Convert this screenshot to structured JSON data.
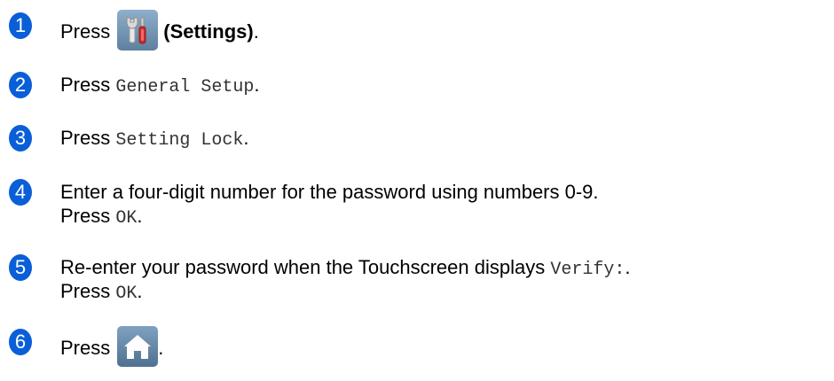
{
  "steps": [
    {
      "number": "1",
      "lines": [
        {
          "prefix": "Press",
          "icon": "settings-icon",
          "bold": "(Settings)",
          "suffix": "."
        }
      ]
    },
    {
      "number": "2",
      "lines": [
        {
          "prefix": "Press ",
          "mono": "General Setup",
          "suffix": "."
        }
      ]
    },
    {
      "number": "3",
      "lines": [
        {
          "prefix": "Press ",
          "mono": "Setting Lock",
          "suffix": "."
        }
      ]
    },
    {
      "number": "4",
      "lines": [
        {
          "text": "Enter a four-digit number for the password using numbers 0-9."
        },
        {
          "prefix": "Press ",
          "mono": "OK",
          "suffix": "."
        }
      ]
    },
    {
      "number": "5",
      "lines": [
        {
          "prefix": "Re-enter your password when the Touchscreen displays ",
          "mono": "Verify:",
          "suffix": "."
        },
        {
          "prefix": "Press ",
          "mono": "OK",
          "suffix": "."
        }
      ]
    },
    {
      "number": "6",
      "lines": [
        {
          "prefix": "Press",
          "icon": "home-icon",
          "suffix": "."
        }
      ]
    }
  ]
}
